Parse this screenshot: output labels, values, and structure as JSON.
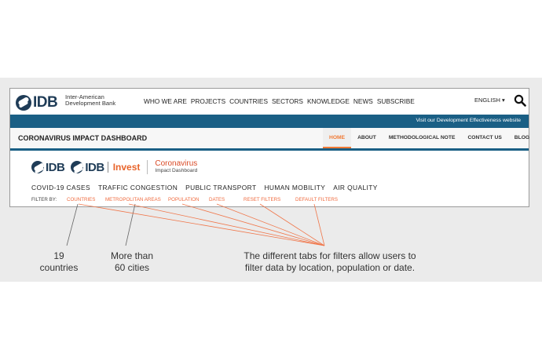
{
  "header": {
    "logo_text": "IDB",
    "bank_name_line1": "Inter-American",
    "bank_name_line2": "Development Bank",
    "nav": [
      "WHO WE ARE",
      "PROJECTS",
      "COUNTRIES",
      "SECTORS",
      "KNOWLEDGE",
      "NEWS",
      "SUBSCRIBE"
    ],
    "language": "ENGLISH ▾",
    "search_icon": "search-icon"
  },
  "bluebar": {
    "link": "Visit our Development Effectiveness website"
  },
  "dashboard": {
    "title": "CORONAVIRUS IMPACT DASHBOARD",
    "subnav": [
      "HOME",
      "ABOUT",
      "METHODOLOGICAL NOTE",
      "CONTACT US",
      "BLOG"
    ],
    "active": "HOME"
  },
  "brands": {
    "idb": "IDB",
    "idb_invest_a": "IDB",
    "invest": "Invest",
    "coronavirus": "Coronavirus",
    "impact_dashboard": "Impact Dashboard"
  },
  "tabs": [
    "COVID-19 CASES",
    "TRAFFIC CONGESTION",
    "PUBLIC TRANSPORT",
    "HUMAN MOBILITY",
    "AIR QUALITY"
  ],
  "filters": {
    "label": "FILTER BY:",
    "items": [
      "COUNTRIES",
      "METROPOLITAN AREAS",
      "POPULATION",
      "DATES",
      "RESET FILTERS",
      "DEFAULT FILTERS"
    ]
  },
  "annotations": {
    "countries_line1": "19",
    "countries_line2": "countries",
    "cities_line1": "More than",
    "cities_line2": "60 cities",
    "filters_line1": "The different tabs for filters allow users to",
    "filters_line2": "filter data by location, population or date."
  },
  "colors": {
    "navy": "#1f3c57",
    "blue_strip": "#1a5f85",
    "accent": "#f07a35",
    "filter_orange": "#ef6a3e"
  }
}
